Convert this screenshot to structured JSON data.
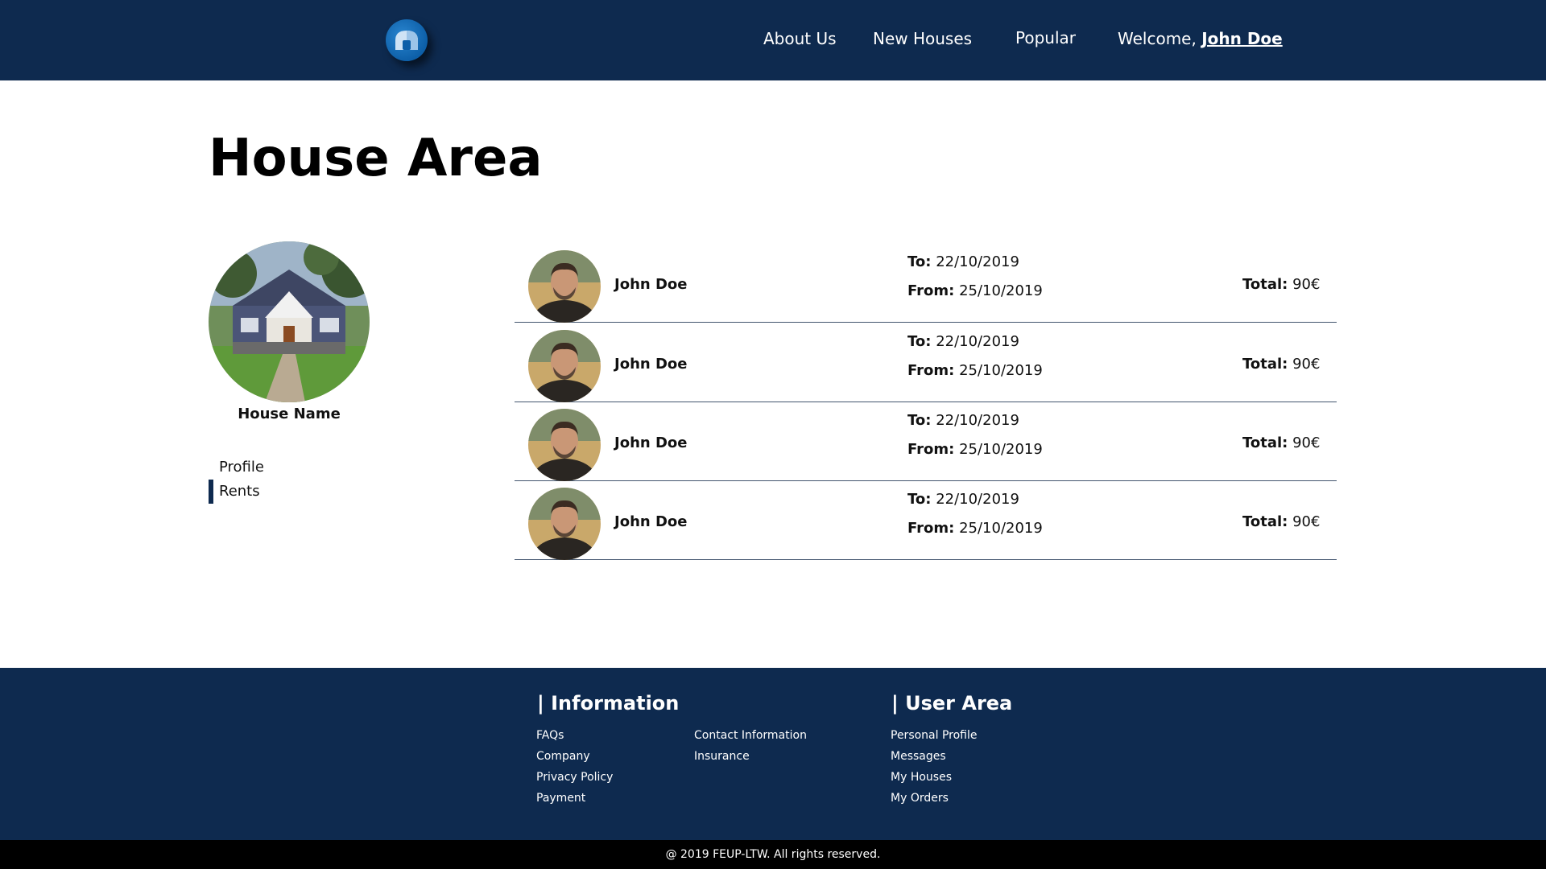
{
  "header": {
    "nav": {
      "about": "About Us",
      "new_houses": "New Houses",
      "popular": "Popular",
      "welcome": "Welcome, ",
      "user": "John Doe"
    }
  },
  "main": {
    "title": "House Area",
    "house_name": "House Name",
    "side_menu": [
      {
        "label": "Profile",
        "active": false
      },
      {
        "label": "Rents",
        "active": true
      }
    ],
    "labels": {
      "to": "To:",
      "from": "From:",
      "total": "Total:"
    },
    "rents": [
      {
        "name": "John Doe",
        "to": "22/10/2019",
        "from": "25/10/2019",
        "total": "90€"
      },
      {
        "name": "John Doe",
        "to": "22/10/2019",
        "from": "25/10/2019",
        "total": "90€"
      },
      {
        "name": "John Doe",
        "to": "22/10/2019",
        "from": "25/10/2019",
        "total": "90€"
      },
      {
        "name": "John Doe",
        "to": "22/10/2019",
        "from": "25/10/2019",
        "total": "90€"
      }
    ]
  },
  "footer": {
    "information": {
      "title": "| Information",
      "links_col1": [
        "FAQs",
        "Company",
        "Privacy Policy",
        "Payment"
      ],
      "links_col2": [
        "Contact Information",
        "Insurance"
      ]
    },
    "user_area": {
      "title": "| User Area",
      "links": [
        "Personal Profile",
        "Messages",
        "My Houses",
        "My Orders"
      ]
    },
    "copyright": "@ 2019 FEUP-LTW. All rights reserved."
  },
  "colors": {
    "primary": "#0e2a4f",
    "logo": "#0d5fa8",
    "copyright_bg": "#000000"
  },
  "icons": {
    "logo": "house-logo-icon",
    "house_photo": "house-photo",
    "avatar": "user-avatar"
  }
}
